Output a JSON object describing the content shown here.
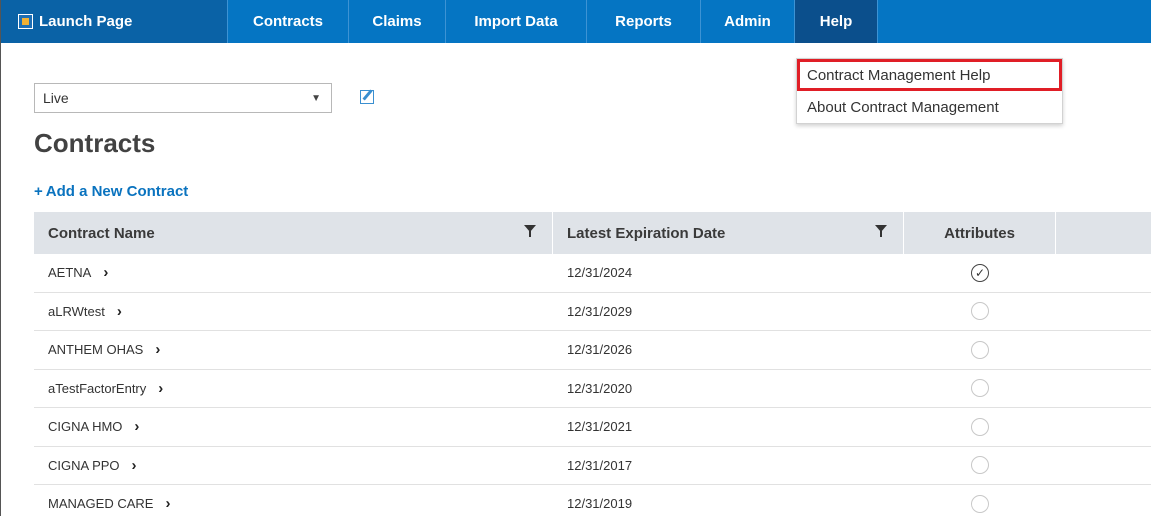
{
  "nav": {
    "launch_label": "Launch Page",
    "items": [
      {
        "label": "Contracts"
      },
      {
        "label": "Claims"
      },
      {
        "label": "Import Data"
      },
      {
        "label": "Reports"
      },
      {
        "label": "Admin"
      },
      {
        "label": "Help"
      }
    ],
    "active": "Help"
  },
  "help_menu": {
    "items": [
      {
        "label": "Contract Management Help",
        "highlighted": true
      },
      {
        "label": "About Contract Management",
        "highlighted": false
      }
    ]
  },
  "toolbar": {
    "environment_value": "Live",
    "caret": "▼"
  },
  "page": {
    "title": "Contracts",
    "add_link": "Add a New Contract",
    "add_icon": "+"
  },
  "table": {
    "columns": [
      "Contract Name",
      "Latest Expiration Date",
      "Attributes",
      ""
    ],
    "rows": [
      {
        "name": "AETNA",
        "date": "12/31/2024",
        "attribute_checked": true
      },
      {
        "name": "aLRWtest",
        "date": "12/31/2029",
        "attribute_checked": false
      },
      {
        "name": "ANTHEM OHAS",
        "date": "12/31/2026",
        "attribute_checked": false
      },
      {
        "name": "aTestFactorEntry",
        "date": "12/31/2020",
        "attribute_checked": false
      },
      {
        "name": "CIGNA HMO",
        "date": "12/31/2021",
        "attribute_checked": false
      },
      {
        "name": "CIGNA PPO",
        "date": "12/31/2017",
        "attribute_checked": false
      },
      {
        "name": "MANAGED CARE",
        "date": "12/31/2019",
        "attribute_checked": false
      }
    ],
    "chevron": "›",
    "check_glyph": "✓"
  },
  "colors": {
    "nav_bg": "#0575c3",
    "nav_active": "#0b4f8c",
    "link": "#0a73bf",
    "highlight_border": "#e01e26",
    "header_bg": "#dfe3e8"
  }
}
